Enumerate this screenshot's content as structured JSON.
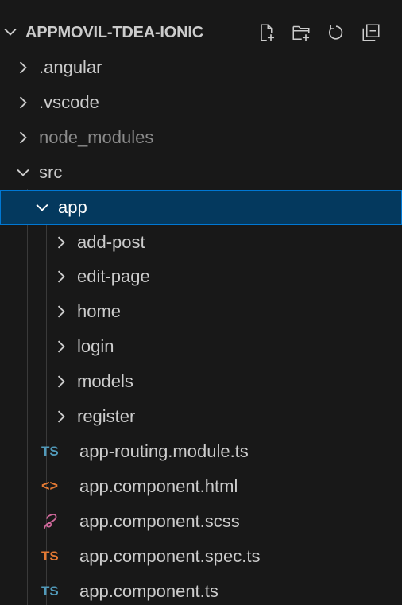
{
  "explorer": {
    "title": "APPMOVIL-TDEA-IONIC",
    "actions": [
      {
        "name": "new-file-icon"
      },
      {
        "name": "new-folder-icon"
      },
      {
        "name": "refresh-icon"
      },
      {
        "name": "collapse-all-icon"
      }
    ],
    "tree": [
      {
        "label": ".angular",
        "kind": "folder",
        "expanded": false
      },
      {
        "label": ".vscode",
        "kind": "folder",
        "expanded": false
      },
      {
        "label": "node_modules",
        "kind": "folder",
        "expanded": false,
        "dimmed": true
      },
      {
        "label": "src",
        "kind": "folder",
        "expanded": true
      },
      {
        "label": "app",
        "kind": "folder",
        "expanded": true,
        "selected": true
      },
      {
        "label": "add-post",
        "kind": "folder",
        "expanded": false
      },
      {
        "label": "edit-page",
        "kind": "folder",
        "expanded": false
      },
      {
        "label": "home",
        "kind": "folder",
        "expanded": false
      },
      {
        "label": "login",
        "kind": "folder",
        "expanded": false
      },
      {
        "label": "models",
        "kind": "folder",
        "expanded": false
      },
      {
        "label": "register",
        "kind": "folder",
        "expanded": false
      },
      {
        "label": "app-routing.module.ts",
        "kind": "file",
        "icon_text": "TS",
        "icon_color": "#519aba"
      },
      {
        "label": "app.component.html",
        "kind": "file",
        "icon_text": "<>",
        "icon_color": "#e37933"
      },
      {
        "label": "app.component.scss",
        "kind": "file",
        "icon_text": "",
        "icon_color": "#cd6799"
      },
      {
        "label": "app.component.spec.ts",
        "kind": "file",
        "icon_text": "TS",
        "icon_color": "#e37933"
      },
      {
        "label": "app.component.ts",
        "kind": "file",
        "icon_text": "TS",
        "icon_color": "#519aba"
      }
    ]
  }
}
